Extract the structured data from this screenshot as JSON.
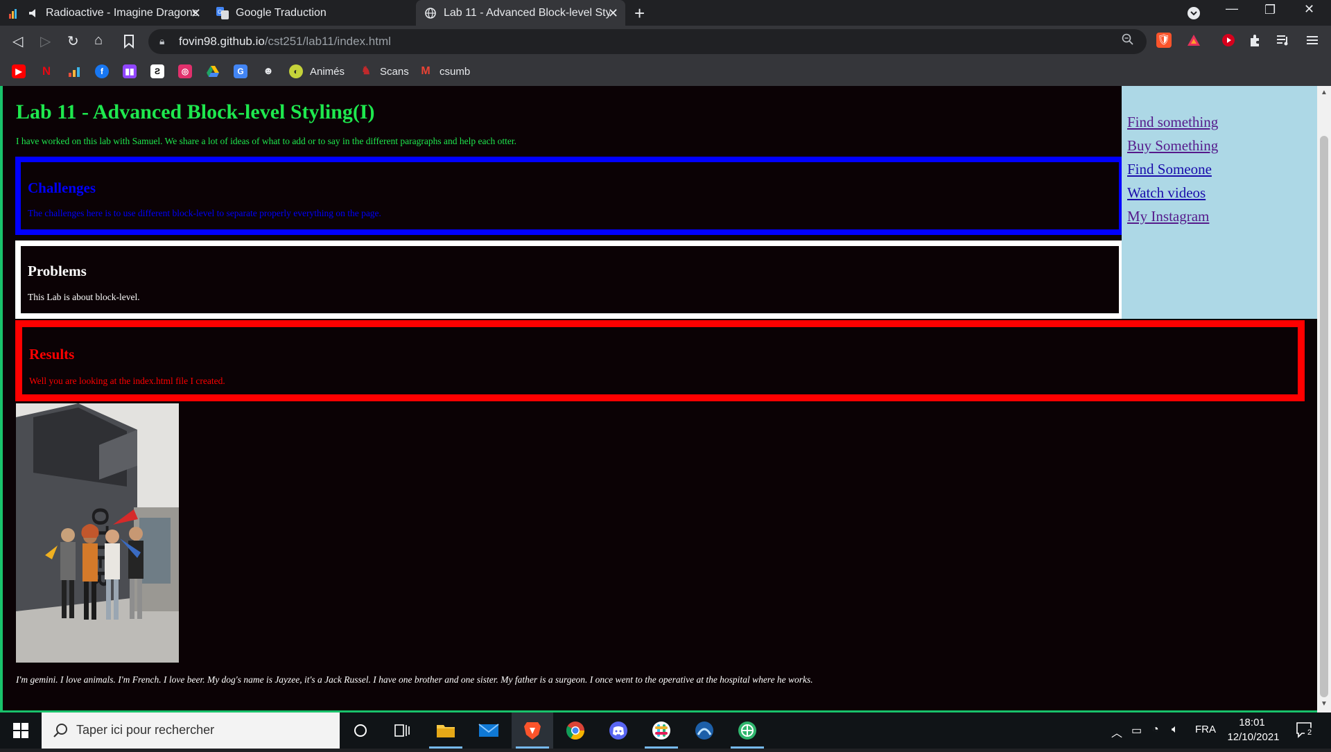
{
  "browser": {
    "tabs": [
      {
        "label": "Radioactive - Imagine Dragons",
        "active": false
      },
      {
        "label": "Google Traduction",
        "active": false
      },
      {
        "label": "Lab 11 - Advanced Block-level Styl",
        "active": true
      }
    ],
    "url_host": "fovin98.github.io",
    "url_path": "/cst251/lab11/index.html",
    "bookmarks": [
      {
        "label": "Animés"
      },
      {
        "label": "Scans"
      },
      {
        "label": "csumb"
      }
    ]
  },
  "page": {
    "title": "Lab 11 - Advanced Block-level Styling(I)",
    "intro": "I have worked on this lab with Samuel. We share a lot of ideas of what to add or to say in the different paragraphs and help each otter.",
    "sections": {
      "challenges": {
        "heading": "Challenges",
        "text": "The challenges here is to use different block-level to separate properly everything on the page.",
        "color": "#0000ff"
      },
      "problems": {
        "heading": "Problems",
        "text": "This Lab is about block-level.",
        "color": "#ffffff"
      },
      "results": {
        "heading": "Results",
        "text": "Well you are looking at the index.html file I created.",
        "color": "#ff0000"
      }
    },
    "nav_links": [
      {
        "label": "Find something"
      },
      {
        "label": "Buy Something"
      },
      {
        "label": "Find Someone"
      },
      {
        "label": "Watch videos"
      },
      {
        "label": "My Instagram"
      }
    ],
    "footer": "I'm gemini. I love animals. I'm French. I love beer. My dog's name is Jayzee, it's a Jack Russel. I have one brother and one sister. My father is a surgeon. I once went to the operative at the hospital where he works.",
    "colors": {
      "title": "#1ee84e",
      "background": "#0b0205",
      "sidenav": "#add8e6"
    }
  },
  "taskbar": {
    "search_placeholder": "Taper ici pour rechercher",
    "language": "FRA",
    "time": "18:01",
    "date": "12/10/2021",
    "notifications": "2"
  }
}
